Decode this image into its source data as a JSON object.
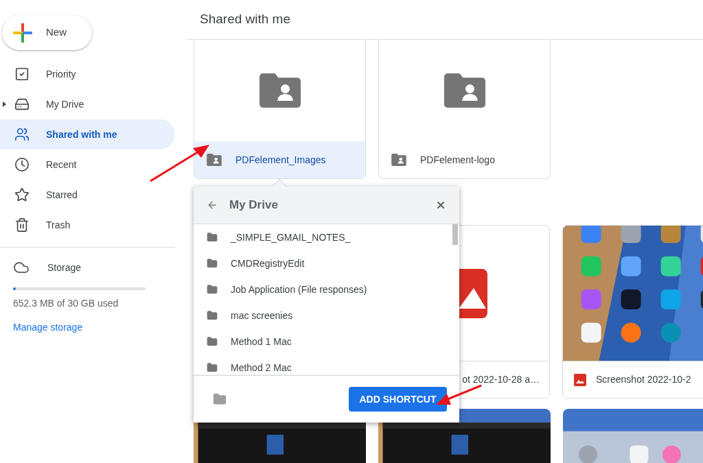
{
  "sidebar": {
    "new_button": "New",
    "items": [
      {
        "label": "Priority",
        "selected": false
      },
      {
        "label": "My Drive",
        "selected": false
      },
      {
        "label": "Shared with me",
        "selected": true
      },
      {
        "label": "Recent",
        "selected": false
      },
      {
        "label": "Starred",
        "selected": false
      },
      {
        "label": "Trash",
        "selected": false
      }
    ],
    "storage": {
      "label": "Storage",
      "level": 0.02,
      "usage": "652.3 MB of 30 GB used",
      "link": "Manage storage"
    }
  },
  "main": {
    "title": "Shared with me",
    "folders": [
      {
        "name": "PDFelement_Images",
        "selected": true
      },
      {
        "name": "PDFelement-logo",
        "selected": false
      }
    ],
    "files": [
      {
        "name": "ot 2022-10-28 a…",
        "kind": "icon"
      },
      {
        "name": "Screenshot 2022-10-2",
        "kind": "picture"
      }
    ]
  },
  "dialog": {
    "title": "My Drive",
    "folders": [
      "_SIMPLE_GMAIL_NOTES_",
      "CMDRegistryEdit",
      "Job Application (File responses)",
      "mac screenies",
      "Method 1 Mac",
      "Method 2 Mac"
    ],
    "button": "ADD SHORTCUT"
  }
}
